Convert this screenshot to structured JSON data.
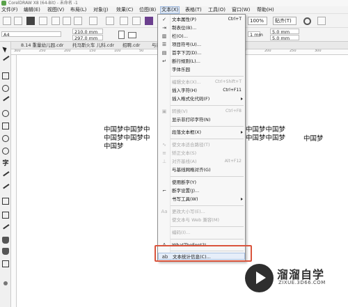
{
  "window": {
    "title": "CorelDRAW X8 (64-Bit) - 未命名 -1"
  },
  "menubar": {
    "items": [
      "文件(F)",
      "编辑(E)",
      "视图(V)",
      "布局(L)",
      "对象(J)",
      "效果(C)",
      "位图(B)",
      "文本(X)",
      "表格(T)",
      "工具(O)",
      "窗口(W)",
      "帮助(H)"
    ],
    "active": "文本(X)"
  },
  "toolbar": {
    "zoom_value": "100%",
    "snap_label": "贴齐(T)"
  },
  "property_bar": {
    "page_size": "A4",
    "width": "210.0 mm",
    "height": "297.0 mm",
    "nudge_x": "5.0 mm",
    "nudge_y": "5.0 mm",
    "units_value": "1 mm"
  },
  "document_tabs": [
    "8.14 重量幼儿园.cdr",
    "托马斯火车 儿科.cdr",
    "招聘.cdr",
    "与送"
  ],
  "ruler": {
    "numbers": [
      "300",
      "250",
      "200",
      "150",
      "100",
      "50",
      "0",
      "50",
      "100",
      "150",
      "200",
      "250",
      "300"
    ]
  },
  "canvas": {
    "text_line1_left": "中国梦中国梦中",
    "text_line2_left": "中国梦中国梦中",
    "text_line3_left": "中国梦",
    "text_line1_right": "中国梦中国梦",
    "text_line2_right": "中国梦中国梦",
    "text_line2_far": "中国梦"
  },
  "text_menu": {
    "items": [
      {
        "label": "文本属性(P)",
        "shortcut": "Ctrl+T",
        "icon": "check-icon",
        "enabled": true
      },
      {
        "label": "制表位(B)...",
        "shortcut": "",
        "icon": "tab-stop-icon",
        "enabled": true
      },
      {
        "label": "栏(O)...",
        "shortcut": "",
        "icon": "columns-icon",
        "enabled": true
      },
      {
        "label": "项目符号(U)...",
        "shortcut": "",
        "icon": "bullets-icon",
        "enabled": true
      },
      {
        "label": "首字下沉(D)...",
        "shortcut": "",
        "icon": "drop-cap-icon",
        "enabled": true
      },
      {
        "label": "断行规则(L)...",
        "shortcut": "",
        "icon": "line-break-icon",
        "enabled": true
      },
      {
        "label": "字体乐园",
        "shortcut": "",
        "icon": "",
        "enabled": true
      },
      {
        "label": "编辑文本(X)...",
        "shortcut": "Ctrl+Shift+T",
        "icon": "",
        "enabled": false
      },
      {
        "label": "插入字符(H)",
        "shortcut": "Ctrl+F11",
        "icon": "",
        "enabled": true
      },
      {
        "label": "插入格式化代码(F)",
        "shortcut": "",
        "icon": "",
        "enabled": true,
        "submenu": true
      },
      {
        "label": "转换(V)",
        "shortcut": "Ctrl+F8",
        "icon": "convert-icon",
        "enabled": false
      },
      {
        "label": "显示非打印字符(N)",
        "shortcut": "",
        "icon": "",
        "enabled": true
      },
      {
        "label": "段落文本框(X)",
        "shortcut": "",
        "icon": "",
        "enabled": true,
        "submenu": true
      },
      {
        "label": "使文本适合路径(T)",
        "shortcut": "",
        "icon": "fit-path-icon",
        "enabled": false
      },
      {
        "label": "矫正文本(S)",
        "shortcut": "",
        "icon": "straighten-icon",
        "enabled": false
      },
      {
        "label": "对齐基线(A)",
        "shortcut": "Alt+F12",
        "icon": "baseline-icon",
        "enabled": false
      },
      {
        "label": "与基线网格对齐(G)",
        "shortcut": "",
        "icon": "",
        "enabled": true
      },
      {
        "label": "使用断字(Y)",
        "shortcut": "",
        "icon": "",
        "enabled": true
      },
      {
        "label": "断字设置(J)...",
        "shortcut": "",
        "icon": "hyphen-icon",
        "enabled": true
      },
      {
        "label": "书写工具(W)",
        "shortcut": "",
        "icon": "",
        "enabled": true,
        "submenu": true
      },
      {
        "label": "更改大小写(E)...",
        "shortcut": "",
        "icon": "change-case-icon",
        "enabled": false
      },
      {
        "label": "使文本与 Web 兼容(M)",
        "shortcut": "",
        "icon": "",
        "enabled": false
      },
      {
        "label": "编码(I)...",
        "shortcut": "",
        "icon": "",
        "enabled": false
      },
      {
        "label": "WhatTheFont?!...",
        "shortcut": "",
        "icon": "whatthefont-icon",
        "enabled": true
      },
      {
        "label": "文本统计信息(C)...",
        "shortcut": "",
        "icon": "statistics-icon",
        "enabled": true,
        "highlighted": true
      }
    ]
  },
  "watermark": {
    "name": "溜溜自学",
    "url": "ZIXUE.3D66.COM"
  }
}
